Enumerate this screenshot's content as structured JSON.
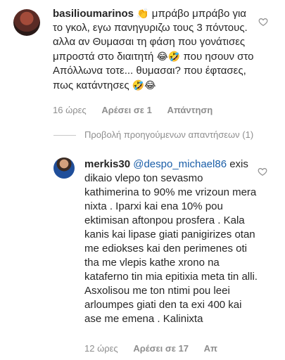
{
  "comment1": {
    "username": "basilioumarinos",
    "emoji_clap": "👏",
    "text_a": " μπράβο μπράβο για το γκολ, εγω πανηγυριζω τους 3 πόντους. αλλα αν  Θυμασαι τη φάση που γονάτισες μπροστά στο διαιτητή ",
    "emoji_a": "😂🤣",
    "text_b": " που ησουν στο Απόλλωνα τοτε... θυμασαι?  που έφτασες, πως κατάντησες ",
    "emoji_b": "🤣😂",
    "time": "16 ώρες",
    "likes": "Αρέσει σε 1",
    "reply": "Απάντηση"
  },
  "view_previous": "Προβολή προηγούμενων απαντήσεων (1)",
  "comment2": {
    "username": "merkis30",
    "mention": "@despo_michael86",
    "text": " exis dikaio vlepo ton sevasmo kathimerina to 90% me vrizoun mera nixta . Iparxi kai ena 10% pou ektimisan aftonpou prosfera . Kala kanis kai lipase giati panigirizes otan me ediokses kai den perimenes oti tha me vlepis kathe xrono na kataferno tin mia epitixia meta tin alli. Asxolisou me ton ntimi pou leei arloumpes giati den ta exi 400 kai ase me emena . Kalinixta",
    "time": "12 ώρες",
    "likes": "Αρέσει σε 17",
    "reply": "Απ"
  },
  "icons": {
    "heart": "heart-outline-icon"
  }
}
